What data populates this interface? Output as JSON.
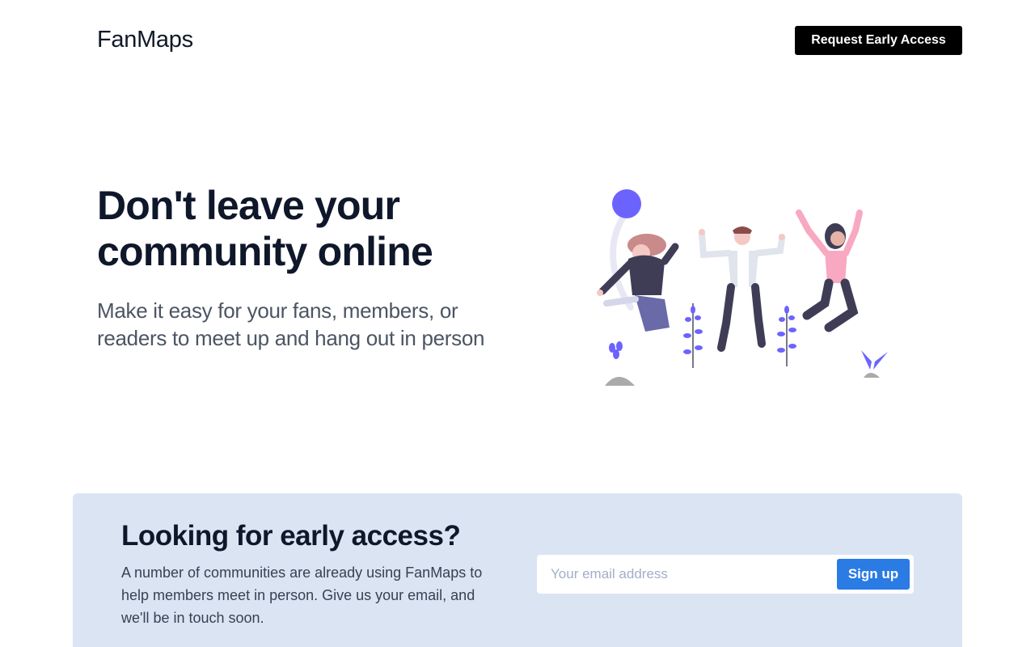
{
  "header": {
    "logo": "FanMaps",
    "cta_label": "Request Early Access"
  },
  "hero": {
    "title": "Don't leave your community online",
    "subtitle": "Make it easy for your fans, members, or readers to meet up and hang out in person",
    "illustration": "people-jumping-illustration"
  },
  "signup": {
    "title": "Looking for early access?",
    "text": "A number of communities are already using FanMaps to help members meet in person. Give us your email, and we'll be in touch soon.",
    "email_placeholder": "Your email address",
    "email_value": "",
    "submit_label": "Sign up"
  },
  "colors": {
    "accent": "#6c63ff",
    "button_blue": "#2a7be4",
    "panel_bg": "#dbe4f3",
    "navy": "#3f3d56",
    "pink": "#f9a8c1"
  }
}
